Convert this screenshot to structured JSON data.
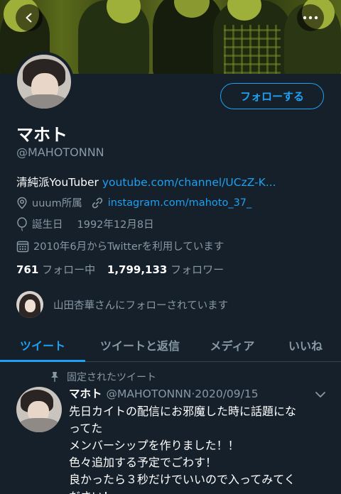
{
  "profile": {
    "name": "マホト",
    "handle": "@MAHOTONNN",
    "follow_label": "フォローする",
    "bio_text": "清純派YouTuber ",
    "bio_link": "youtube.com/channel/UCzZ-K...",
    "location": "uuum所属",
    "website": "instagram.com/mahoto_37_",
    "birthday_label": "誕生日",
    "birthday_value": "1992年12月8日",
    "joined": "2010年6月からTwitterを利用しています",
    "following_count": "761",
    "following_label": "フォロー中",
    "followers_count": "1,799,133",
    "followers_label": "フォロワー",
    "followed_by_text": "山田杏華さんにフォローされています"
  },
  "tabs": [
    {
      "label": "ツイート",
      "active": true
    },
    {
      "label": "ツイートと返信",
      "active": false
    },
    {
      "label": "メディア",
      "active": false
    },
    {
      "label": "いいね",
      "active": false
    }
  ],
  "tweet": {
    "pinned_label": "固定されたツイート",
    "name": "マホト",
    "handle": "@MAHOTONNN",
    "separator": "·",
    "date": "2020/09/15",
    "lines": [
      "先日カイトの配信にお邪魔した時に話題にな",
      "ってた",
      "メンバーシップを作りました！！",
      "色々追加する予定でごわす！",
      "良かったら３秒だけでいいので入ってみてく",
      "ださい！"
    ]
  },
  "colors": {
    "background": "#15202b",
    "accent": "#1da1f2",
    "secondary_text": "#8899a6",
    "divider": "#38444d"
  },
  "icons": {
    "back": "chevron-left-icon",
    "more": "more-horizontal-icon",
    "location": "location-pin-icon",
    "link": "link-icon",
    "birthday": "balloon-icon",
    "calendar": "calendar-icon",
    "pin": "pin-icon",
    "caret": "chevron-down-icon"
  }
}
